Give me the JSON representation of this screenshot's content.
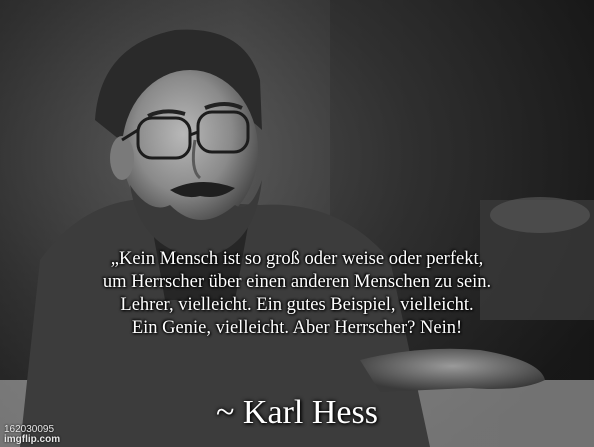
{
  "quote": {
    "lines": [
      "„Kein Mensch ist so groß oder weise oder perfekt,",
      "um Herrscher über einen anderen Menschen zu sein.",
      "Lehrer, vielleicht. Ein gutes Beispiel, vielleicht.",
      "Ein Genie, vielleicht. Aber Herrscher? Nein!"
    ],
    "author": "~ Karl Hess"
  },
  "watermark": {
    "id": "162030095",
    "site": "imgflip.com"
  },
  "colors": {
    "text": "#ffffff",
    "photo_tone": "grayscale"
  }
}
